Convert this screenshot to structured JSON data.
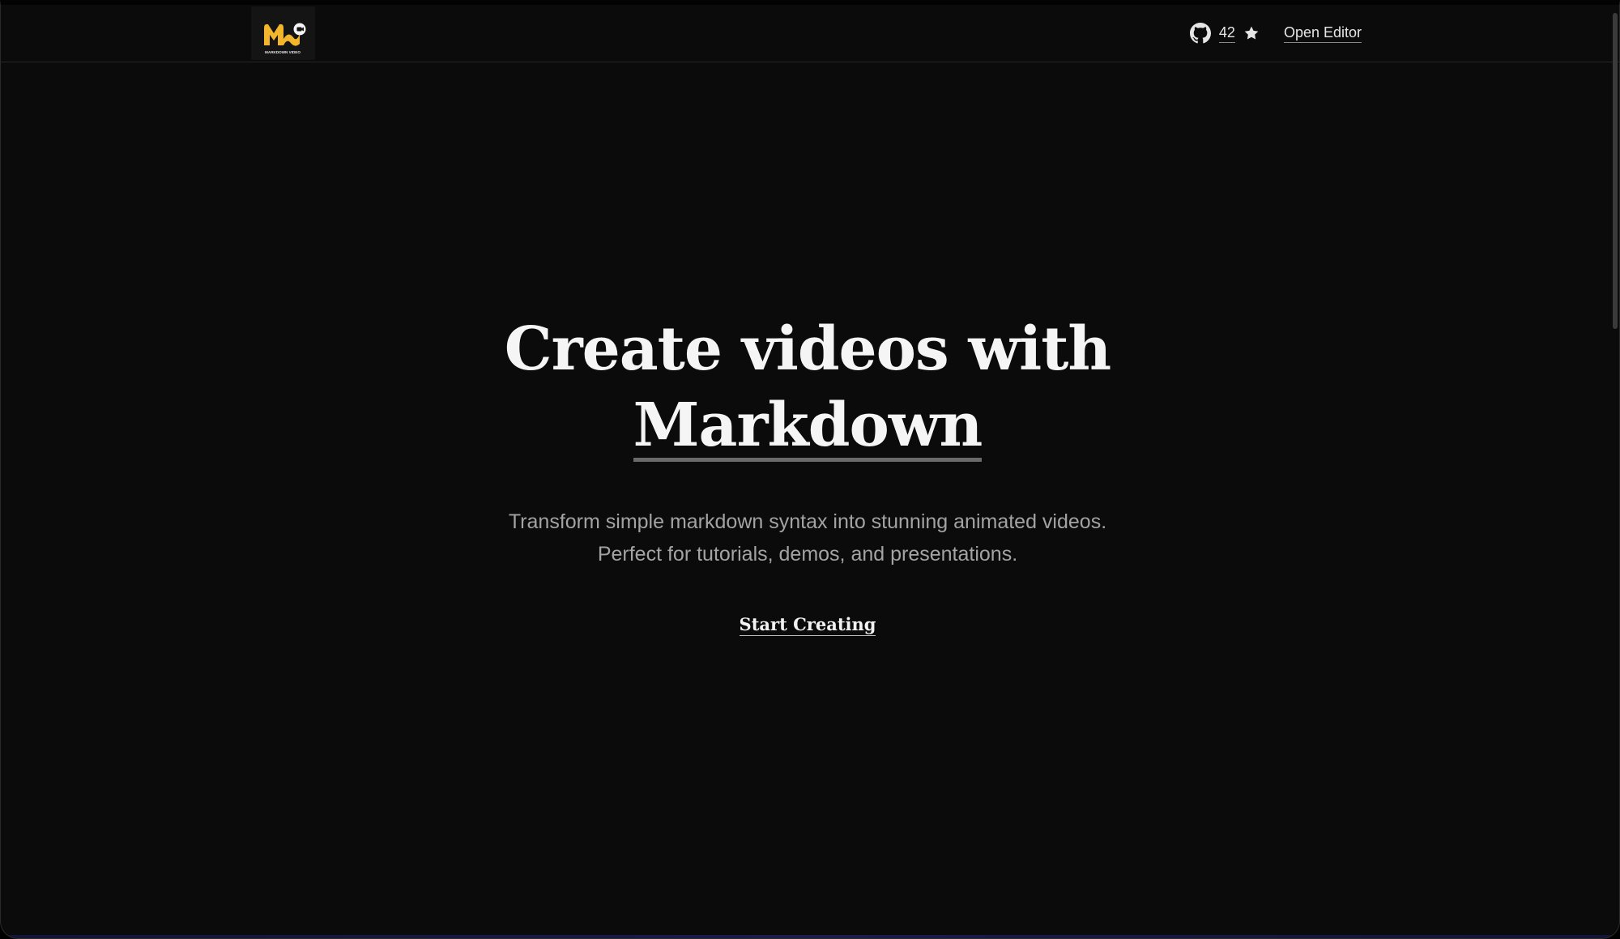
{
  "header": {
    "logo_text": "MARKDOWN VIDEO",
    "github_stars": "42",
    "open_editor_label": "Open Editor"
  },
  "hero": {
    "headline_line1": "Create videos with",
    "headline_line2": "Markdown",
    "subtitle_line1": "Transform simple markdown syntax into stunning animated videos.",
    "subtitle_line2": "Perfect for tutorials, demos, and presentations.",
    "cta_label": "Start Creating"
  },
  "icons": {
    "github": "github-icon",
    "star": "star-icon"
  },
  "colors": {
    "background": "#0b0b0b",
    "text_primary": "#f5f5f5",
    "text_muted": "#a3a3a3",
    "logo_accent": "#f2b52b"
  }
}
